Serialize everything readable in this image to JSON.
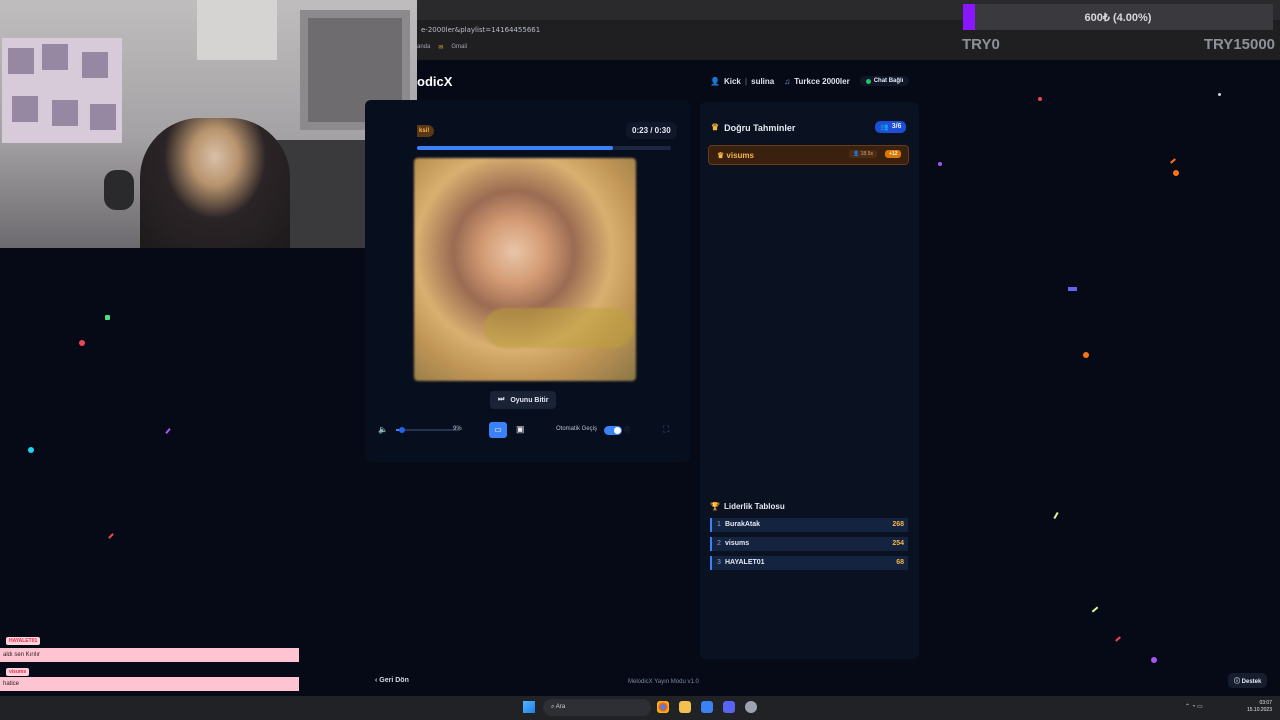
{
  "browser": {
    "url": "e-2000ler&playlist=14164455661",
    "bookmarks": [
      "anda",
      "Gmail"
    ]
  },
  "donation_goal": {
    "amount_text": "600₺ (4.00%)",
    "progress_percent": 4.0,
    "min_label": "TRY0",
    "max_label": "TRY15000",
    "colors": {
      "fill": "#8a16ff"
    }
  },
  "app": {
    "brand": "odicX",
    "platform_label": "Kick",
    "user": "sulina",
    "playlist": "Turkce 2000ler",
    "chat_status": "Chat Bağlı"
  },
  "player": {
    "hint_badge": "ksi!",
    "time": "0:23 / 0:30",
    "progress_fraction": 0.77,
    "end_button": "Oyunu Bitir",
    "volume_percent": "9%",
    "volume_fraction": 0.09,
    "auto_switch_label": "Otomatik Geçiş",
    "auto_switch_on": true
  },
  "correct_guesses": {
    "title": "Doğru Tahminler",
    "count": "3/6",
    "items": [
      {
        "name": "visums",
        "time": "18.5s",
        "points": "+12"
      }
    ]
  },
  "leaderboard": {
    "title": "Liderlik Tablosu",
    "rows": [
      {
        "rank": "1",
        "name": "BurakAtak",
        "score": "268"
      },
      {
        "rank": "2",
        "name": "visums",
        "score": "254"
      },
      {
        "rank": "3",
        "name": "HAYALET01",
        "score": "68"
      }
    ]
  },
  "footer": {
    "back": "Geri Dön",
    "version": "MelodicX Yayın Modu v1.0",
    "support": "Destek"
  },
  "chat": [
    {
      "user": "HAYALET01",
      "message": "aldı sen Kırılır"
    },
    {
      "user": "visums",
      "message": "hatice"
    }
  ],
  "taskbar": {
    "search": "Ara",
    "time": "03:07",
    "date": "15.10.2023"
  },
  "colors": {
    "accent": "#3b82f6",
    "gold": "#f7b548",
    "background": "#050a16"
  }
}
